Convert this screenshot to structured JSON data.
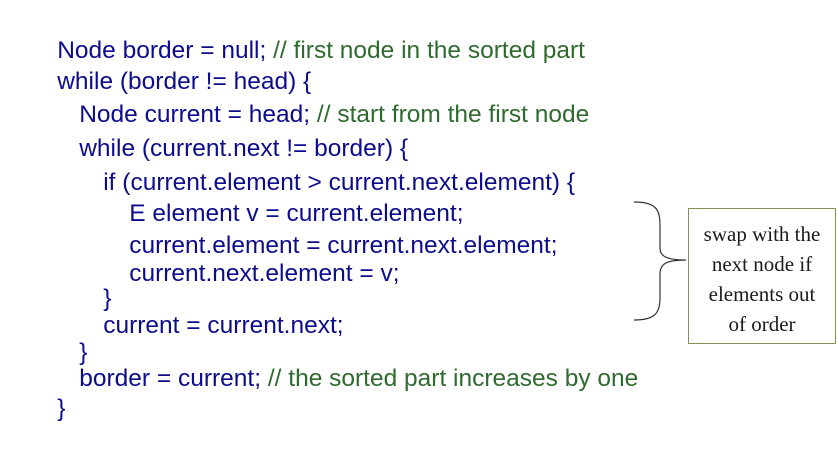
{
  "code_lines": [
    {
      "code": "Node border = null; ",
      "comment": "// first node in the sorted part"
    },
    {
      "code": "while (border != head) {",
      "comment": ""
    },
    {
      "code": "Node current = head; ",
      "comment": "// start from the first node"
    },
    {
      "code": "while (current.next != border) {",
      "comment": ""
    },
    {
      "code": "if (current.element > current.next.element) {",
      "comment": ""
    },
    {
      "code": "E element v = current.element;",
      "comment": ""
    },
    {
      "code": "current.element = current.next.element;",
      "comment": ""
    },
    {
      "code": "current.next.element = v;",
      "comment": ""
    },
    {
      "code": "}",
      "comment": ""
    },
    {
      "code": "current = current.next;",
      "comment": ""
    },
    {
      "code": "}",
      "comment": ""
    },
    {
      "code": "border = current; ",
      "comment": "// the sorted part increases by one"
    },
    {
      "code": "}",
      "comment": ""
    }
  ],
  "callout": {
    "lines": [
      "swap with the",
      "next node if",
      "elements out",
      "of order"
    ]
  },
  "colors": {
    "code": "#0c0c8c",
    "comment": "#2f6a2f",
    "callout_border": "#8a8f5a"
  }
}
